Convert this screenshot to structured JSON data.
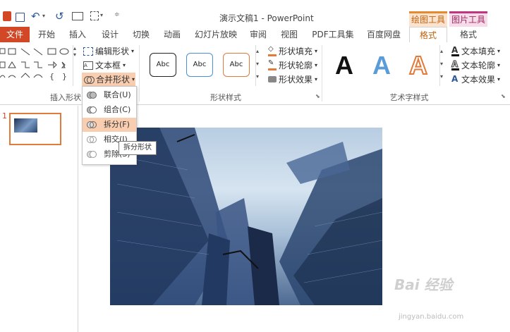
{
  "titlebar": {
    "title": "演示文稿1 - PowerPoint",
    "context_drawing": "绘图工具",
    "context_picture": "图片工具"
  },
  "tabs": [
    "文件",
    "开始",
    "插入",
    "设计",
    "切换",
    "动画",
    "幻灯片放映",
    "审阅",
    "视图",
    "PDF工具集",
    "百度网盘",
    "格式",
    "格式"
  ],
  "ribbon": {
    "insert_shapes": {
      "edit_shape": "编辑形状",
      "text_box": "文本框",
      "merge_shapes": "合并形状",
      "label": "插入形状"
    },
    "shape_styles": {
      "samples": [
        "Abc",
        "Abc",
        "Abc"
      ],
      "fill": "形状填充",
      "outline": "形状轮廓",
      "effects": "形状效果",
      "label": "形状样式"
    },
    "wordart": {
      "samples": [
        "A",
        "A",
        "A"
      ],
      "text_fill": "文本填充",
      "text_outline": "文本轮廓",
      "text_effects": "文本效果",
      "label": "艺术字样式"
    }
  },
  "merge_menu": {
    "items": [
      "联合(U)",
      "组合(C)",
      "拆分(F)",
      "相交(I)",
      "剪除(S)"
    ]
  },
  "tooltip": "拆分形状",
  "slides": {
    "number": "1"
  },
  "watermark": {
    "line1": "Bai 经验",
    "line2": "jingyan.baidu.com"
  },
  "colors": {
    "file_tab": "#d24726",
    "drawing_tools": "#e58a2d",
    "picture_tools": "#c0357e",
    "accent_orange": "#e07b3c",
    "accent_blue": "#4a90d9"
  }
}
